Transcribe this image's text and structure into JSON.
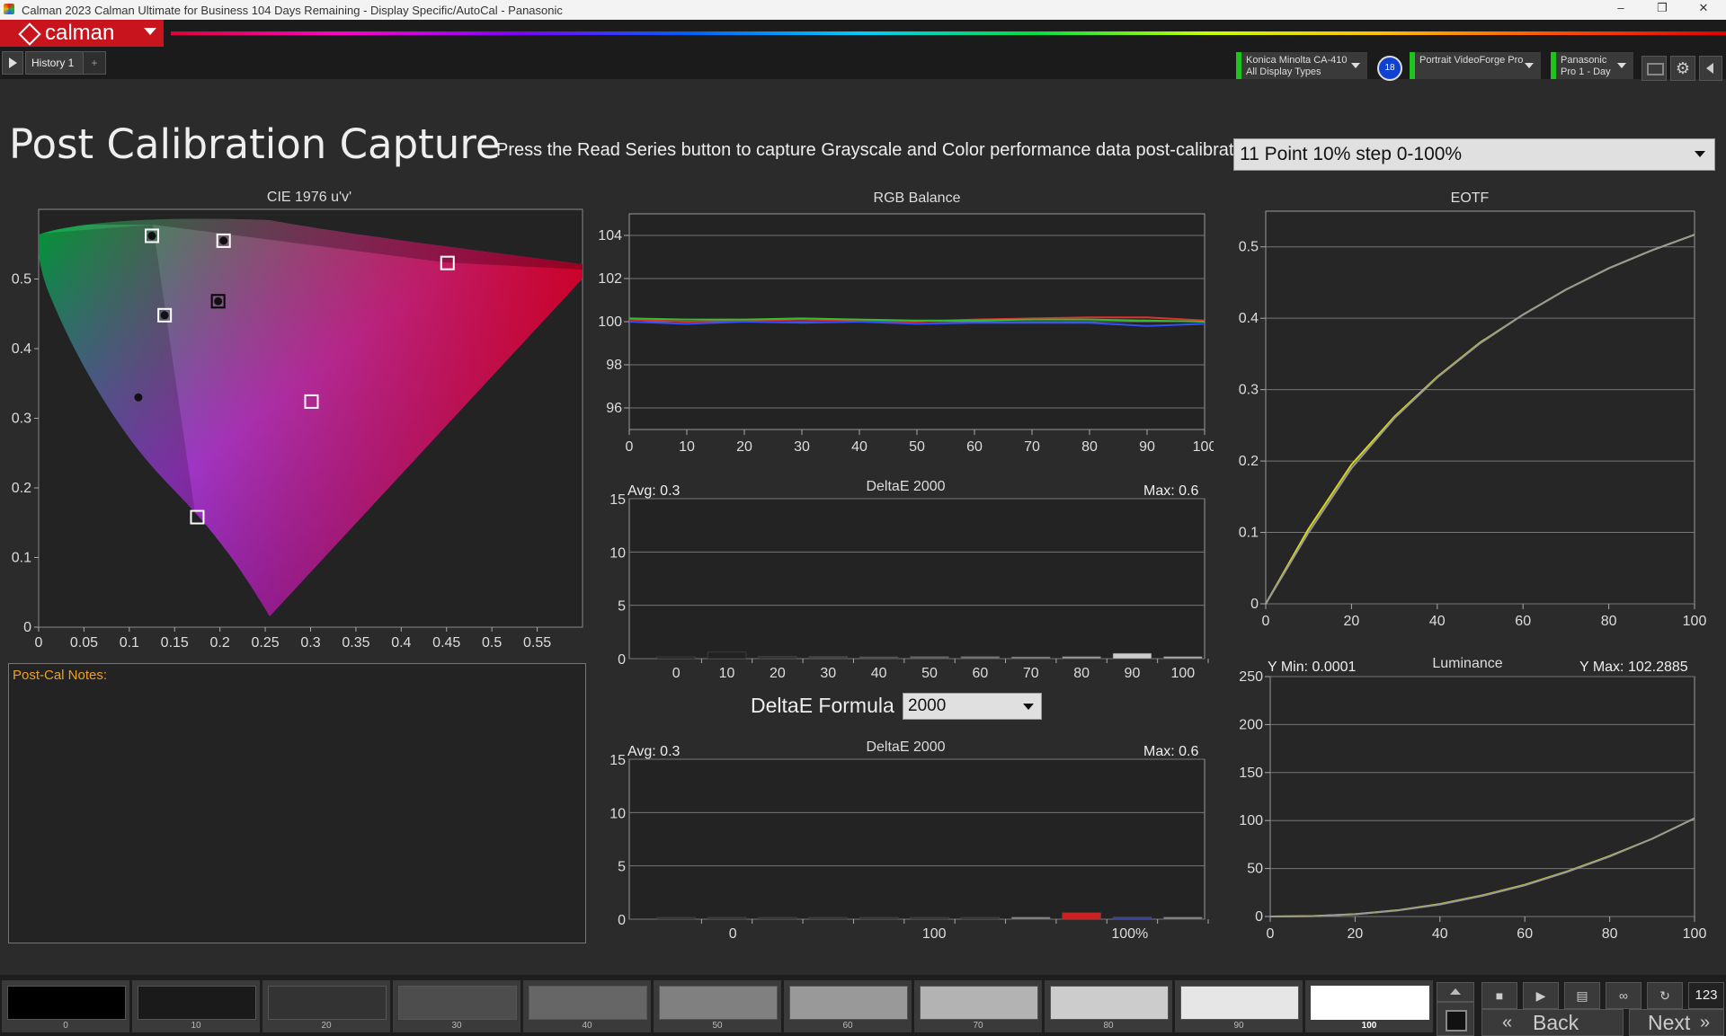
{
  "window": {
    "title": "Calman 2023 Calman Ultimate for Business 104 Days Remaining  - Display Specific/AutoCal - Panasonic"
  },
  "app": {
    "logo": "calman"
  },
  "tabs": [
    {
      "label": "History 1"
    },
    {
      "label": "+"
    }
  ],
  "devices": {
    "meter": {
      "line1": "Konica Minolta CA-410",
      "line2": "All Display Types"
    },
    "meter_badge": "18",
    "generator": {
      "line1": "Portrait VideoForge Pro",
      "line2": ""
    },
    "display": {
      "line1": "Panasonic",
      "line2": "Pro 1 - Day"
    }
  },
  "page": {
    "title": "Post Calibration Capture",
    "instruction": "Press the Read Series button to capture Grayscale and Color performance data post-calibration.",
    "series_select": "11 Point 10% step 0-100%"
  },
  "notes": {
    "label": "Post-Cal Notes:"
  },
  "deltae_formula": {
    "label": "DeltaE Formula",
    "value": "2000"
  },
  "bottom": {
    "patches": [
      {
        "label": "0",
        "color": "#000000"
      },
      {
        "label": "10",
        "color": "#1a1a1a"
      },
      {
        "label": "20",
        "color": "#333333"
      },
      {
        "label": "30",
        "color": "#4d4d4d"
      },
      {
        "label": "40",
        "color": "#666666"
      },
      {
        "label": "50",
        "color": "#808080"
      },
      {
        "label": "60",
        "color": "#999999"
      },
      {
        "label": "70",
        "color": "#b3b3b3"
      },
      {
        "label": "80",
        "color": "#cccccc"
      },
      {
        "label": "90",
        "color": "#e6e6e6"
      },
      {
        "label": "100",
        "color": "#ffffff"
      }
    ],
    "counter": "123",
    "back": "Back",
    "next": "Next"
  },
  "chart_data": [
    {
      "type": "scatter",
      "title": "CIE 1976 u'v'",
      "x_ticks": [
        "0",
        "0.05",
        "0.1",
        "0.15",
        "0.2",
        "0.25",
        "0.3",
        "0.35",
        "0.4",
        "0.45",
        "0.5",
        "0.55"
      ],
      "y_ticks": [
        "0",
        "0.1",
        "0.2",
        "0.3",
        "0.4",
        "0.5"
      ],
      "xlim": [
        0,
        0.6
      ],
      "ylim": [
        0,
        0.6
      ],
      "targets": [
        {
          "name": "red",
          "u": 0.451,
          "v": 0.523
        },
        {
          "name": "green",
          "u": 0.125,
          "v": 0.562
        },
        {
          "name": "blue",
          "u": 0.175,
          "v": 0.158
        },
        {
          "name": "cyan",
          "u": 0.139,
          "v": 0.448
        },
        {
          "name": "magenta",
          "u": 0.301,
          "v": 0.324
        },
        {
          "name": "yellow",
          "u": 0.204,
          "v": 0.555
        },
        {
          "name": "white",
          "u": 0.198,
          "v": 0.468
        }
      ],
      "measured": [
        {
          "u": 0.125,
          "v": 0.562
        },
        {
          "u": 0.204,
          "v": 0.555
        },
        {
          "u": 0.139,
          "v": 0.448
        },
        {
          "u": 0.198,
          "v": 0.468
        },
        {
          "u": 0.11,
          "v": 0.33
        }
      ]
    },
    {
      "type": "line",
      "title": "RGB Balance",
      "x": [
        0,
        10,
        20,
        30,
        40,
        50,
        60,
        70,
        80,
        90,
        100
      ],
      "xlim": [
        0,
        100
      ],
      "ylim": [
        95,
        105
      ],
      "x_ticks": [
        "0",
        "10",
        "20",
        "30",
        "40",
        "50",
        "60",
        "70",
        "80",
        "90",
        "100"
      ],
      "y_ticks": [
        "96",
        "98",
        "100",
        "102",
        "104"
      ],
      "series": [
        {
          "color": "#e03030",
          "values": [
            100.1,
            100.0,
            100.05,
            100.1,
            100.05,
            100.0,
            100.1,
            100.15,
            100.2,
            100.2,
            100.05
          ]
        },
        {
          "color": "#30c030",
          "values": [
            100.15,
            100.1,
            100.1,
            100.15,
            100.1,
            100.05,
            100.05,
            100.1,
            100.1,
            100.05,
            100.0
          ]
        },
        {
          "color": "#3050ff",
          "values": [
            100.0,
            99.9,
            100.0,
            99.95,
            100.0,
            99.9,
            99.95,
            99.95,
            99.95,
            99.8,
            99.9
          ]
        }
      ]
    },
    {
      "type": "bar",
      "title": "DeltaE 2000",
      "avg": "Avg: 0.3",
      "max": "Max: 0.6",
      "categories": [
        "0",
        "10",
        "20",
        "30",
        "40",
        "50",
        "60",
        "70",
        "80",
        "90",
        "100"
      ],
      "values": [
        0.1,
        0.6,
        0.2,
        0.2,
        0.1,
        0.2,
        0.2,
        0.1,
        0.2,
        0.5,
        0.2
      ],
      "colors": [
        "#222",
        "#222",
        "#333",
        "#444",
        "#555",
        "#666",
        "#777",
        "#888",
        "#999",
        "#ccc",
        "#aaa"
      ],
      "ylim": [
        0,
        15
      ],
      "y_ticks": [
        "0",
        "5",
        "10",
        "15"
      ]
    },
    {
      "type": "bar",
      "title": "DeltaE 2000",
      "avg": "Avg: 0.3",
      "max": "Max: 0.6",
      "x_ticks": [
        "0",
        "100",
        "100%"
      ],
      "values": [
        0.1,
        0.1,
        0.1,
        0.1,
        0.1,
        0.1,
        0.1,
        0.2,
        0.6,
        0.2,
        0.2
      ],
      "colors": [
        "#333",
        "#333",
        "#333",
        "#333",
        "#333",
        "#333",
        "#333",
        "#888",
        "#d02020",
        "#3040c0",
        "#888"
      ],
      "ylim": [
        0,
        15
      ],
      "y_ticks": [
        "0",
        "5",
        "10",
        "15"
      ]
    },
    {
      "type": "line",
      "title": "EOTF",
      "x": [
        0,
        10,
        20,
        30,
        40,
        50,
        60,
        70,
        80,
        90,
        100
      ],
      "xlim": [
        0,
        100
      ],
      "ylim": [
        0,
        0.55
      ],
      "x_ticks": [
        "0",
        "20",
        "40",
        "60",
        "80",
        "100"
      ],
      "y_ticks": [
        "0",
        "0.1",
        "0.2",
        "0.3",
        "0.4",
        "0.5"
      ],
      "series": [
        {
          "color": "#d8d818",
          "values": [
            0,
            0.105,
            0.195,
            0.262,
            0.318,
            0.366,
            0.405,
            0.44,
            0.47,
            0.495,
            0.517
          ]
        },
        {
          "color": "#999999",
          "values": [
            0,
            0.1,
            0.19,
            0.26,
            0.317,
            0.365,
            0.405,
            0.44,
            0.47,
            0.495,
            0.517
          ]
        }
      ]
    },
    {
      "type": "line",
      "title": "Luminance",
      "y_min_label": "Y Min: 0.0001",
      "y_max_label": "Y Max: 102.2885",
      "x": [
        0,
        10,
        20,
        30,
        40,
        50,
        60,
        70,
        80,
        90,
        100
      ],
      "xlim": [
        0,
        100
      ],
      "ylim": [
        0,
        250
      ],
      "x_ticks": [
        "0",
        "20",
        "40",
        "60",
        "80",
        "100"
      ],
      "y_ticks": [
        "0",
        "50",
        "100",
        "150",
        "200",
        "250"
      ],
      "series": [
        {
          "color": "#d8d818",
          "values": [
            0,
            0.5,
            2.5,
            6.5,
            13,
            22,
            33,
            47,
            63,
            81,
            102.3
          ]
        },
        {
          "color": "#999999",
          "values": [
            0,
            0.4,
            2.3,
            6.3,
            12.5,
            21.5,
            32.5,
            46.5,
            62.5,
            81,
            102.3
          ]
        }
      ]
    }
  ]
}
